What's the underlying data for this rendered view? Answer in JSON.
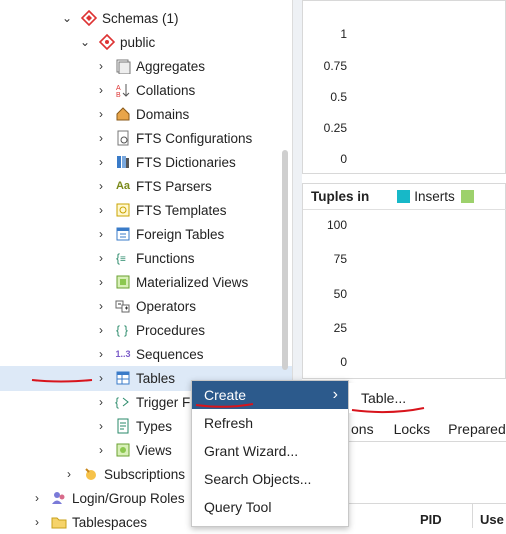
{
  "tree": {
    "schemas": "Schemas (1)",
    "public": "public",
    "items": [
      {
        "label": "Aggregates"
      },
      {
        "label": "Collations"
      },
      {
        "label": "Domains"
      },
      {
        "label": "FTS Configurations"
      },
      {
        "label": "FTS Dictionaries"
      },
      {
        "label": "FTS Parsers"
      },
      {
        "label": "FTS Templates"
      },
      {
        "label": "Foreign Tables"
      },
      {
        "label": "Functions"
      },
      {
        "label": "Materialized Views"
      },
      {
        "label": "Operators"
      },
      {
        "label": "Procedures"
      },
      {
        "label": "Sequences"
      },
      {
        "label": "Tables"
      },
      {
        "label": "Trigger Fu"
      },
      {
        "label": "Types"
      },
      {
        "label": "Views"
      }
    ],
    "subscriptions": "Subscriptions",
    "login_roles": "Login/Group Roles",
    "tablespaces": "Tablespaces",
    "parsers_glyph": "Aa",
    "sequences_glyph": "1..3"
  },
  "chart_top": {
    "ticks": [
      "1",
      "0.75",
      "0.5",
      "0.25",
      "0"
    ]
  },
  "chart_tuples": {
    "title": "Tuples in",
    "legend": "Inserts",
    "legend_color": "#17b8c8",
    "legend2_color": "#9dd16c",
    "ticks": [
      "100",
      "75",
      "50",
      "25",
      "0"
    ]
  },
  "context_menu": {
    "create": "Create",
    "refresh": "Refresh",
    "grant": "Grant Wizard...",
    "search": "Search Objects...",
    "query": "Query Tool",
    "submenu_table": "Table..."
  },
  "tabs": {
    "a": "ons",
    "b": "Locks",
    "c": "Prepared"
  },
  "grid_headers": {
    "pid": "PID",
    "user": "Use"
  }
}
